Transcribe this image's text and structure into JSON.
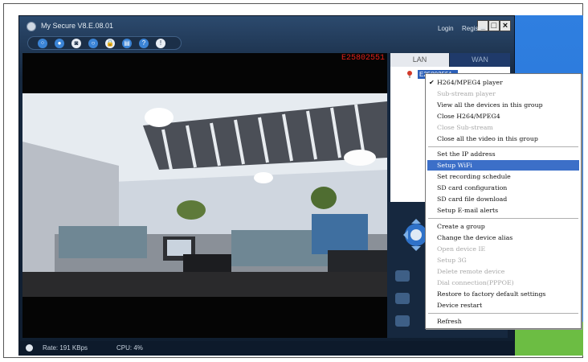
{
  "window": {
    "title": "My Secure  V8.E.08.01",
    "minimize": "_",
    "maximize": "□",
    "close": "×"
  },
  "header": {
    "login": "Login",
    "register": "Register"
  },
  "toolbar": {
    "tools": [
      {
        "icon": "camera-grid-icon",
        "glyph": "⁘"
      },
      {
        "icon": "record-icon",
        "glyph": "●"
      },
      {
        "icon": "snapshot-icon",
        "glyph": "◙"
      },
      {
        "icon": "search-icon",
        "glyph": "○"
      },
      {
        "icon": "lock-icon",
        "glyph": "🔒"
      },
      {
        "icon": "save-icon",
        "glyph": "▤"
      },
      {
        "icon": "help-icon",
        "glyph": "?"
      },
      {
        "icon": "info-icon",
        "glyph": "!"
      }
    ]
  },
  "video": {
    "device_id": "E25802551"
  },
  "tabs": {
    "lan": "LAN",
    "wan": "WAN"
  },
  "device_tree": {
    "node": "E25802551"
  },
  "context_menu": {
    "items": [
      {
        "label": "H264/MPEG4 player",
        "checked": true,
        "disabled": false
      },
      {
        "label": "Sub-stream player",
        "disabled": true
      },
      {
        "label": "View all the devices in this group",
        "disabled": false
      },
      {
        "label": "Close H264/MPEG4",
        "disabled": false
      },
      {
        "label": "Close Sub-stream",
        "disabled": true
      },
      {
        "label": "Close all the video in this group",
        "disabled": false
      },
      {
        "label": "Set the IP address",
        "disabled": false
      },
      {
        "label": "Setup WiFi",
        "disabled": false,
        "highlighted": true
      },
      {
        "label": "Set recording schedule",
        "disabled": false
      },
      {
        "label": "SD card configuration",
        "disabled": false
      },
      {
        "label": "SD card file download",
        "disabled": false
      },
      {
        "label": "Setup E-mail alerts",
        "disabled": false
      },
      {
        "label": "Create a group",
        "disabled": false
      },
      {
        "label": "Change the device alias",
        "disabled": false
      },
      {
        "label": "Open device IE",
        "disabled": true
      },
      {
        "label": "Setup 3G",
        "disabled": true
      },
      {
        "label": "Delete remote device",
        "disabled": true
      },
      {
        "label": "Dial connection(PPPOE)",
        "disabled": true
      },
      {
        "label": "Restore to factory default settings",
        "disabled": false
      },
      {
        "label": "Device restart",
        "disabled": false
      },
      {
        "label": "Refresh",
        "disabled": false
      }
    ]
  },
  "status": {
    "rate": "Rate: 191 KBps",
    "cpu": "CPU:  4%"
  }
}
